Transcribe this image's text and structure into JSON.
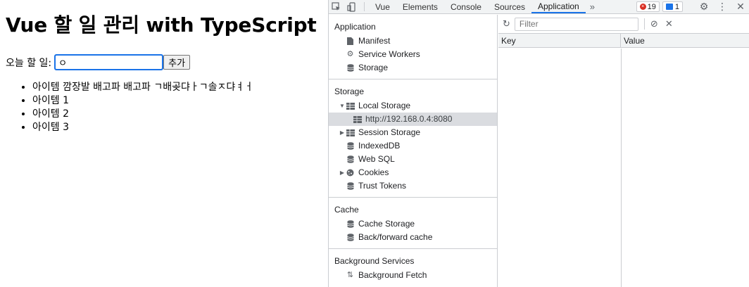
{
  "page": {
    "title": "Vue 할 일 관리 with TypeScript",
    "input_label": "오늘 할 일:",
    "input_value": "ㅇ",
    "add_button": "추가",
    "items": [
      "아이템 깜장발 배고파 배고파 ㄱ배곶댜ㅏㄱ솔ㅈ댜ㅕㅓ",
      "아이템 1",
      "아이템 2",
      "아이템 3"
    ]
  },
  "devtools": {
    "tabs": [
      "Vue",
      "Elements",
      "Console",
      "Sources",
      "Application"
    ],
    "active_tab": "Application",
    "error_count": "19",
    "message_count": "1",
    "sidebar": {
      "application": {
        "title": "Application",
        "items": [
          "Manifest",
          "Service Workers",
          "Storage"
        ]
      },
      "storage": {
        "title": "Storage",
        "local_storage": "Local Storage",
        "local_storage_origin": "http://192.168.0.4:8080",
        "session_storage": "Session Storage",
        "indexeddb": "IndexedDB",
        "websql": "Web SQL",
        "cookies": "Cookies",
        "trust_tokens": "Trust Tokens"
      },
      "cache": {
        "title": "Cache",
        "items": [
          "Cache Storage",
          "Back/forward cache"
        ]
      },
      "background": {
        "title": "Background Services",
        "items": [
          "Background Fetch"
        ]
      }
    },
    "filter_placeholder": "Filter",
    "columns": {
      "key": "Key",
      "value": "Value"
    },
    "accent_color": "#1a73e8"
  }
}
